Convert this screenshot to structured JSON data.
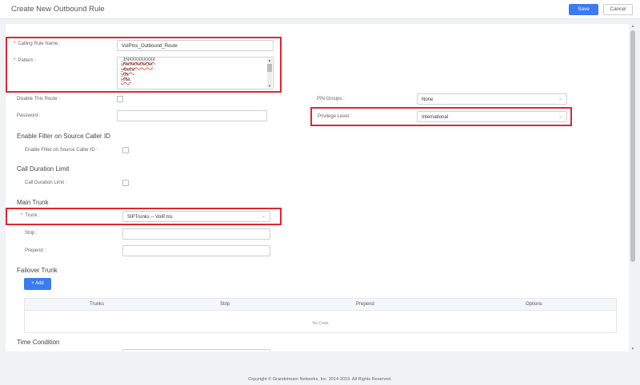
{
  "header": {
    "title": "Create New Outbound Rule",
    "save_label": "Save",
    "cancel_label": "Cancel"
  },
  "form": {
    "calling_rule_name": {
      "label": "Calling Rule Name :",
      "value": "VoIPms_Outbound_Route"
    },
    "pattern": {
      "label": "Pattern :",
      "lines": [
        "_1NXXXXXXXXX",
        "_NXXXXXXXXX",
        "_4XXX",
        "_00.",
        "_011."
      ]
    },
    "disable_route": {
      "label": "Disable This Route :"
    },
    "password": {
      "label": "Password :",
      "value": ""
    },
    "pin_groups": {
      "label": "PIN Groups :",
      "value": "None"
    },
    "privilege_level": {
      "label": "Privilege Level :",
      "value": "International"
    },
    "source_caller_filter": {
      "section": "Enable Filter on Source Caller ID",
      "label": "Enable Filter on Source Caller ID :"
    },
    "call_duration": {
      "section": "Call Duration Limit",
      "label": "Call Duration Limit :"
    },
    "main_trunk": {
      "section": "Main Trunk",
      "trunk_label": "Trunk :",
      "trunk_value": "SIPTrunks -- VoIP.ms",
      "strip_label": "Strip :",
      "strip_value": "",
      "prepend_label": "Prepend :",
      "prepend_value": ""
    },
    "failover_trunk": {
      "section": "Failover Trunk",
      "add_label": "Add",
      "columns": [
        "Trunks",
        "Strip",
        "Prepend",
        "Options"
      ],
      "empty_text": "No Data"
    },
    "time_condition": {
      "section": "Time Condition"
    }
  },
  "footer": {
    "copyright": "Copyright © Grandstream Networks, Inc. 2014-2019. All Rights Reserved."
  },
  "colors": {
    "primary": "#3a7bf0",
    "highlight": "#e0262e",
    "required": "#e22233"
  }
}
